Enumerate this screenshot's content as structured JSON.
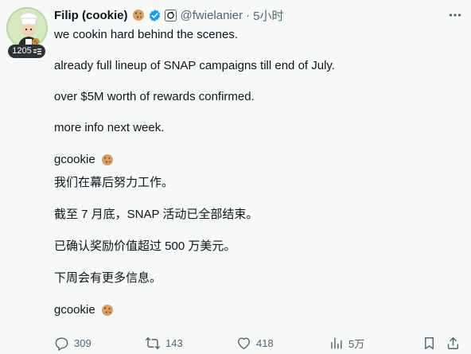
{
  "author": {
    "display_name": "Filip (cookie)",
    "handle": "@fwielanier",
    "separator": "·",
    "time": "5小时",
    "avatar_badge_count": "1205",
    "verified_color": "#1d9bf0"
  },
  "tweet": {
    "lines": [
      "we cookin hard behind the scenes.",
      "already full lineup of SNAP campaigns till end of July.",
      "over $5M worth of rewards confirmed.",
      "more info next week.",
      "gcookie",
      "我们在幕后努力工作。",
      "截至 7 月底，SNAP 活动已全部结束。",
      "已确认奖励价值超过 500 万美元。",
      "下周会有更多信息。",
      "gcookie"
    ]
  },
  "actions": {
    "reply_count": "309",
    "retweet_count": "143",
    "like_count": "418",
    "views_count": "5万",
    "icon_color": "#536471"
  },
  "icons": {
    "more": "more-horizontal-icon",
    "verified": "verified-badge-icon",
    "affiliate": "affiliate-badge-icon",
    "cookie": "cookie-emoji-icon",
    "reply": "reply-icon",
    "retweet": "retweet-icon",
    "like": "heart-icon",
    "views": "views-chart-icon",
    "bookmark": "bookmark-icon",
    "share": "share-icon",
    "followers": "followers-icon"
  }
}
